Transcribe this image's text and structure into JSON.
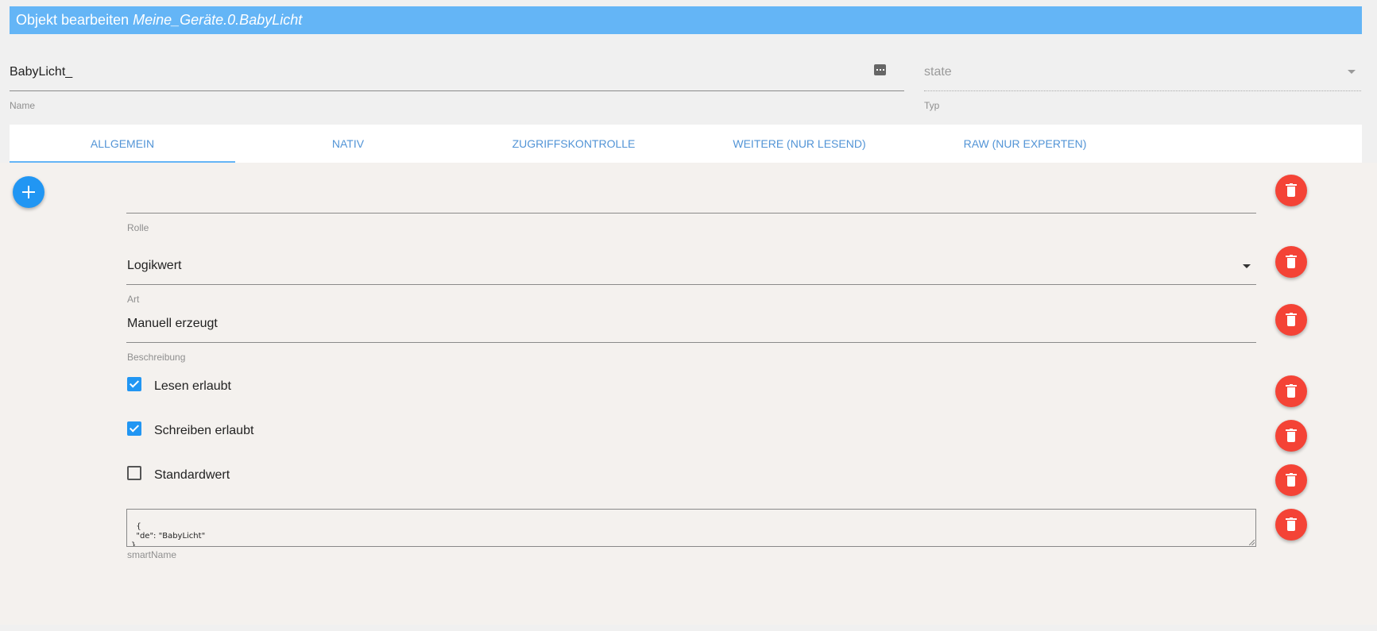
{
  "header": {
    "prefix": "Objekt bearbeiten",
    "object_id": "Meine_Geräte.0.BabyLicht"
  },
  "name_field": {
    "value": "BabyLicht_",
    "label": "Name",
    "button_icon": "more-horizontal-icon"
  },
  "type_field": {
    "value": "state",
    "label": "Typ"
  },
  "tabs": [
    {
      "label": "Allgemein",
      "active": true
    },
    {
      "label": "Nativ",
      "active": false
    },
    {
      "label": "Zugriffskontrolle",
      "active": false
    },
    {
      "label": "Weitere (nur lesend)",
      "active": false
    },
    {
      "label": "RAW (nur Experten)",
      "active": false
    }
  ],
  "fields": {
    "role": {
      "value": "",
      "label": "Rolle"
    },
    "art": {
      "value": "Logikwert",
      "label": "Art"
    },
    "beschreibung": {
      "value": "Manuell erzeugt",
      "label": "Beschreibung"
    },
    "lesen": {
      "label": "Lesen erlaubt",
      "checked": true
    },
    "schreiben": {
      "label": "Schreiben erlaubt",
      "checked": true
    },
    "standardwert": {
      "label": "Standardwert",
      "checked": false
    },
    "smartname": {
      "value": "{\n  \"de\": \"BabyLicht\"\n}",
      "label": "smartName"
    }
  },
  "colors": {
    "header_bg": "#64b5f6",
    "accent": "#2196f3",
    "delete": "#f44336",
    "tab_text": "#5294d6"
  }
}
